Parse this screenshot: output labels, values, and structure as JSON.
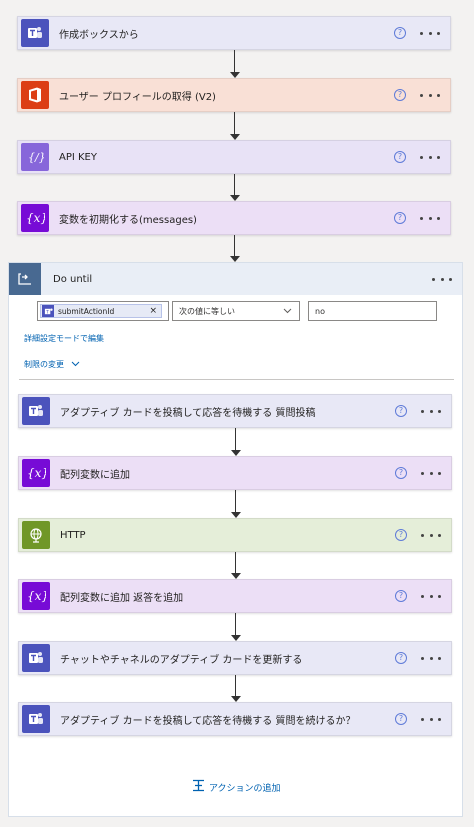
{
  "top_steps": [
    {
      "title": "作成ボックスから",
      "icon": "teams-icon",
      "bg": "#e8e8f6",
      "icon_bg": "#4b53bc"
    },
    {
      "title": "ユーザー プロフィールの取得 (V2)",
      "icon": "office-icon",
      "bg": "#f9e0d6",
      "icon_bg": "#dc3e15"
    },
    {
      "title": "API KEY",
      "icon": "expression-icon",
      "bg": "#e8e2f6",
      "icon_bg": "#8766da"
    },
    {
      "title": "変数を初期化する(messages)",
      "icon": "variable-icon",
      "bg": "#ecdff6",
      "icon_bg": "#770bd6"
    }
  ],
  "do_until": {
    "title": "Do until",
    "condition": {
      "token_label": "submitActionId",
      "token_remove": "×",
      "operator": "次の値に等しい",
      "value": "no"
    },
    "advanced_mode_link": "詳細設定モードで編集",
    "change_limits_link": "制限の変更",
    "inner_steps": [
      {
        "title": "アダプティブ カードを投稿して応答を待機する 質問投稿",
        "icon": "teams-icon",
        "bg": "#e8e8f6",
        "icon_bg": "#4b53bc"
      },
      {
        "title": "配列変数に追加",
        "icon": "variable-icon",
        "bg": "#ecdff6",
        "icon_bg": "#770bd6"
      },
      {
        "title": "HTTP",
        "icon": "globe-icon",
        "bg": "#e5eed9",
        "icon_bg": "#709727"
      },
      {
        "title": "配列変数に追加 返答を追加",
        "icon": "variable-icon",
        "bg": "#ecdff6",
        "icon_bg": "#770bd6"
      },
      {
        "title": "チャットやチャネルのアダプティブ カードを更新する",
        "icon": "teams-icon",
        "bg": "#e8e8f6",
        "icon_bg": "#4b53bc"
      },
      {
        "title": "アダプティブ カードを投稿して応答を待機する 質問を続けるか？",
        "icon": "teams-icon",
        "bg": "#e8e8f6",
        "icon_bg": "#4b53bc"
      }
    ],
    "add_action_label": "アクションの追加"
  },
  "help_glyph": "?"
}
